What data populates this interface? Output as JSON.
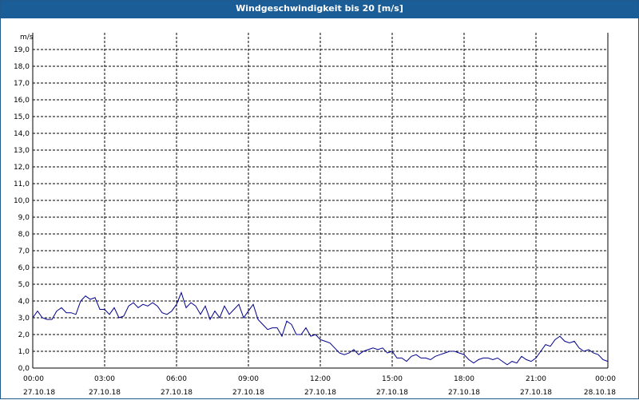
{
  "window": {
    "title": "Windgeschwindigkeit bis 20 [m/s]"
  },
  "colors": {
    "titlebar": "#1b5d96",
    "line": "#00008b",
    "grid": "#000000",
    "background": "#ffffff"
  },
  "chart_data": {
    "type": "line",
    "title": "Windgeschwindigkeit bis 20 [m/s]",
    "ylabel": "m/s",
    "xlabel": "",
    "ylim": [
      0,
      20
    ],
    "xlim_hours": [
      0,
      24
    ],
    "grid": true,
    "y_ticks": [
      "0,0",
      "1,0",
      "2,0",
      "3,0",
      "4,0",
      "5,0",
      "6,0",
      "7,0",
      "8,0",
      "9,0",
      "10,0",
      "11,0",
      "12,0",
      "13,0",
      "14,0",
      "15,0",
      "16,0",
      "17,0",
      "18,0",
      "19,0"
    ],
    "x_ticks": [
      {
        "time": "00:00",
        "date": "27.10.18"
      },
      {
        "time": "03:00",
        "date": "27.10.18"
      },
      {
        "time": "06:00",
        "date": "27.10.18"
      },
      {
        "time": "09:00",
        "date": "27.10.18"
      },
      {
        "time": "12:00",
        "date": "27.10.18"
      },
      {
        "time": "15:00",
        "date": "27.10.18"
      },
      {
        "time": "18:00",
        "date": "27.10.18"
      },
      {
        "time": "21:00",
        "date": "27.10.18"
      },
      {
        "time": "00:00",
        "date": "28.10.18"
      }
    ],
    "series": [
      {
        "x": [
          0.0,
          0.2,
          0.4,
          0.6,
          0.8,
          1.0,
          1.2,
          1.4,
          1.6,
          1.8,
          2.0,
          2.2,
          2.4,
          2.6,
          2.8,
          3.0,
          3.2,
          3.4,
          3.6,
          3.8,
          4.0,
          4.2,
          4.4,
          4.6,
          4.8,
          5.0,
          5.2,
          5.4,
          5.6,
          5.8,
          6.0,
          6.2,
          6.4,
          6.6,
          6.8,
          7.0,
          7.2,
          7.4,
          7.6,
          7.8,
          8.0,
          8.2,
          8.4,
          8.6,
          8.8,
          9.0,
          9.2,
          9.4,
          9.6,
          9.8,
          10.0,
          10.2,
          10.4,
          10.6,
          10.8,
          11.0,
          11.2,
          11.4,
          11.6,
          11.8,
          12.0,
          12.2,
          12.4,
          12.6,
          12.8,
          13.0,
          13.2,
          13.4,
          13.6,
          13.8,
          14.0,
          14.2,
          14.4,
          14.6,
          14.8,
          15.0,
          15.2,
          15.4,
          15.6,
          15.8,
          16.0,
          16.2,
          16.4,
          16.6,
          16.8,
          17.0,
          17.2,
          17.4,
          17.6,
          17.8,
          18.0,
          18.2,
          18.4,
          18.6,
          18.8,
          19.0,
          19.2,
          19.4,
          19.6,
          19.8,
          20.0,
          20.2,
          20.4,
          20.6,
          20.8,
          21.0,
          21.2,
          21.4,
          21.6,
          21.8,
          22.0,
          22.2,
          22.4,
          22.6,
          22.8,
          23.0,
          23.2,
          23.4,
          23.6,
          23.8,
          24.0
        ],
        "values": [
          3.0,
          3.4,
          3.0,
          2.9,
          2.9,
          3.4,
          3.6,
          3.3,
          3.3,
          3.2,
          4.0,
          4.3,
          4.1,
          4.2,
          3.5,
          3.5,
          3.2,
          3.6,
          3.0,
          3.1,
          3.7,
          3.9,
          3.6,
          3.8,
          3.7,
          3.9,
          3.7,
          3.3,
          3.2,
          3.4,
          3.8,
          4.5,
          3.6,
          3.9,
          3.7,
          3.2,
          3.7,
          2.9,
          3.4,
          3.0,
          3.7,
          3.2,
          3.5,
          3.8,
          3.0,
          3.4,
          3.8,
          2.9,
          2.6,
          2.3,
          2.4,
          2.4,
          1.9,
          2.8,
          2.6,
          2.0,
          2.0,
          2.4,
          1.9,
          2.0,
          1.7,
          1.6,
          1.5,
          1.2,
          0.9,
          0.8,
          0.9,
          1.1,
          0.8,
          1.0,
          1.1,
          1.2,
          1.1,
          1.2,
          0.9,
          1.0,
          0.6,
          0.6,
          0.4,
          0.7,
          0.8,
          0.6,
          0.6,
          0.5,
          0.7,
          0.8,
          0.9,
          1.0,
          1.0,
          0.9,
          0.8,
          0.5,
          0.3,
          0.5,
          0.6,
          0.6,
          0.5,
          0.6,
          0.4,
          0.2,
          0.4,
          0.3,
          0.7,
          0.5,
          0.4,
          0.6,
          1.0,
          1.4,
          1.3,
          1.7,
          1.9,
          1.6,
          1.5,
          1.6,
          1.2,
          1.0,
          1.1,
          0.9,
          0.8,
          0.5,
          0.4
        ]
      }
    ]
  }
}
